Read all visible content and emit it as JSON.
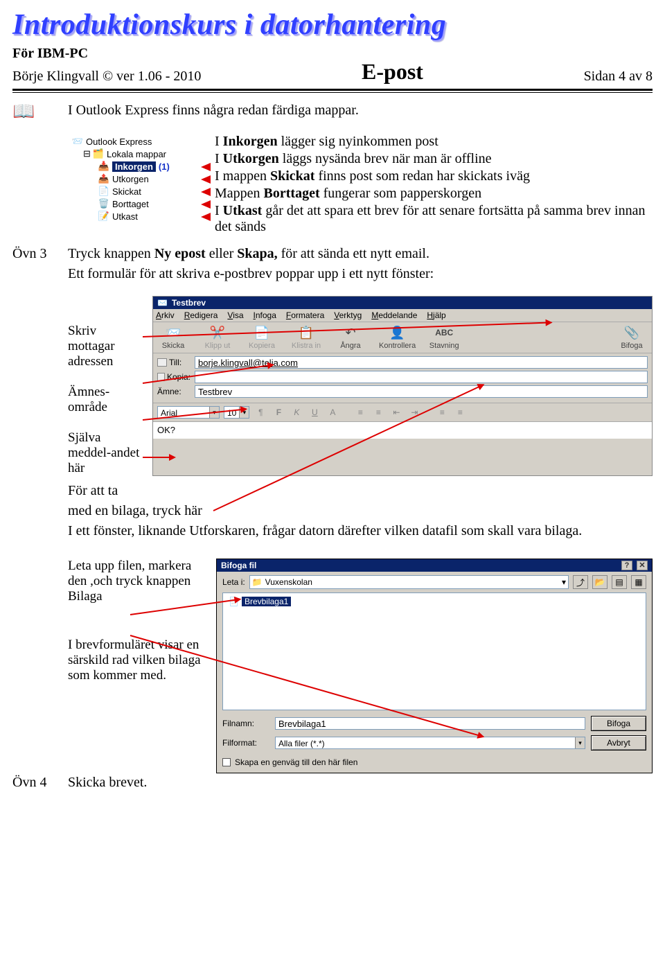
{
  "header": {
    "title_art": "Introduktionskurs i datorhantering",
    "platform": "För IBM-PC",
    "copyright": "Börje Klingvall © ver 1.06  - 2010",
    "subject": "E-post",
    "page_label": "Sidan 4 av 8"
  },
  "intro_line": "I Outlook Express finns några redan färdiga mappar.",
  "tree": {
    "root": "Outlook Express",
    "local": "Lokala mappar",
    "inbox_label": "Inkorgen",
    "inbox_count": "(1)",
    "outbox": "Utkorgen",
    "sent": "Skickat",
    "deleted": "Borttaget",
    "drafts": "Utkast"
  },
  "tree_desc": {
    "l1a": "I ",
    "l1b": "Inkorgen",
    "l1c": " lägger sig nyinkommen post",
    "l2a": "I ",
    "l2b": "Utkorgen",
    "l2c": " läggs nysända brev när man är offline",
    "l3a": "I mappen ",
    "l3b": "Skickat",
    "l3c": " finns post som redan har skickats iväg",
    "l4a": "Mappen ",
    "l4b": "Borttaget",
    "l4c": " fungerar som papperskorgen",
    "l5a": "I ",
    "l5b": "Utkast",
    "l5c": " går det att spara ett brev för att senare fortsätta på samma brev innan det sänds"
  },
  "ovn3_label": "Övn 3",
  "ovn3_text1": "Tryck knappen ",
  "ovn3_b1": "Ny epost",
  "ovn3_mid": " eller ",
  "ovn3_b2": "Skapa,",
  "ovn3_rest": " för att sända ett nytt email.",
  "ovn3_line2": "Ett formulär för att skriva e-postbrev poppar upp i ett nytt fönster:",
  "compose_labels": {
    "addr": "Skriv mottagar adressen",
    "subj": "Ämnes-område",
    "body": "Själva meddel-andet här"
  },
  "compose": {
    "window_title": "Testbrev",
    "menu": [
      "Arkiv",
      "Redigera",
      "Visa",
      "Infoga",
      "Formatera",
      "Verktyg",
      "Meddelande",
      "Hjälp"
    ],
    "toolbar": {
      "send": "Skicka",
      "cut": "Klipp ut",
      "copy": "Kopiera",
      "paste": "Klistra in",
      "undo": "Ångra",
      "check": "Kontrollera",
      "spell": "Stavning",
      "attach": "Bifoga"
    },
    "to_label": "Till:",
    "to_value": "borje.klingvall@telia.com",
    "cc_label": "Kopia:",
    "cc_value": "",
    "subject_label": "Ämne:",
    "subject_value": "Testbrev",
    "font_name": "Arial",
    "font_size": "10",
    "body_text": "OK?"
  },
  "attach_text1": "För att ta",
  "attach_text2": "med en bilaga, tryck här",
  "attach_text3": "I ett fönster, liknande Utforskaren, frågar datorn därefter vilken datafil som skall vara bilaga.",
  "opendlg": {
    "title": "Bifoga fil",
    "lookin_label": "Leta i:",
    "folder": "Vuxenskolan",
    "file": "Brevbilaga1",
    "filename_label": "Filnamn:",
    "filename_value": "Brevbilaga1",
    "filter_label": "Filformat:",
    "filter_value": "Alla filer (*.*)",
    "attach_btn": "Bifoga",
    "cancel_btn": "Avbryt",
    "shortcut_chk": "Skapa en genväg till den här filen"
  },
  "leta_text": "Leta upp filen, markera den ,och tryck knappen Bilaga",
  "final_text": "I brevformuläret visar en särskild rad vilken bilaga som kommer med.",
  "ovn4_label": "Övn 4",
  "ovn4_text": "Skicka brevet."
}
